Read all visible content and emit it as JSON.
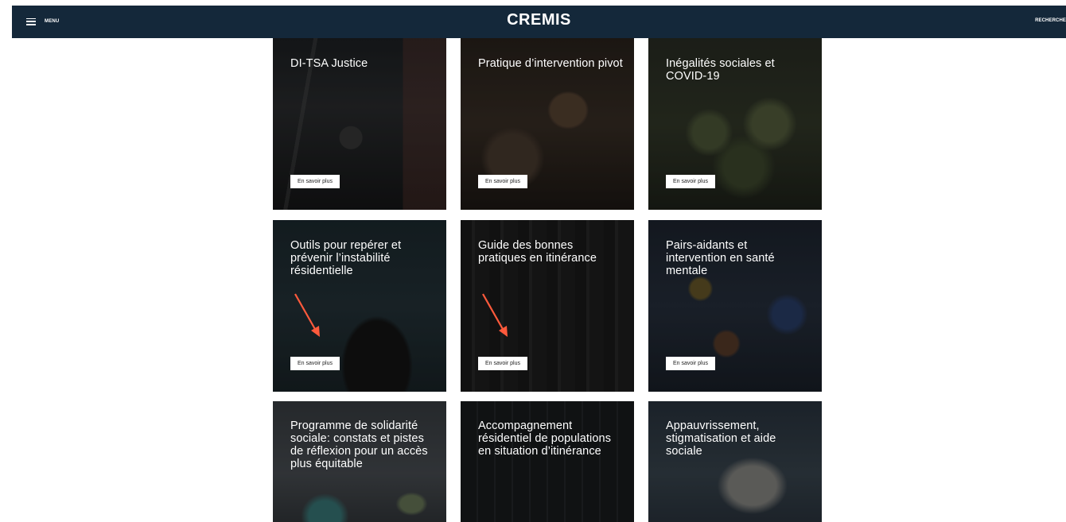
{
  "header": {
    "menu_label": "MENU",
    "brand": "CREMIS",
    "search_label": "RECHERCHE"
  },
  "colors": {
    "header_bg": "#14283a",
    "annotation_arrow": "#ff5a3c"
  },
  "cards": [
    {
      "title": "DI-TSA Justice",
      "button": "En savoir plus"
    },
    {
      "title": "Pratique d’intervention pivot",
      "button": "En savoir plus"
    },
    {
      "title": "Inégalités sociales et COVID-19",
      "button": "En savoir plus"
    },
    {
      "title": "Outils pour repérer et prévenir l’instabilité résidentielle",
      "button": "En savoir plus"
    },
    {
      "title": "Guide des bonnes pratiques en itinérance",
      "button": "En savoir plus"
    },
    {
      "title": "Pairs-aidants et intervention en santé mentale",
      "button": "En savoir plus"
    },
    {
      "title": "Programme de solidarité sociale: constats et pistes de réflexion pour un accès plus équitable"
    },
    {
      "title": "Accompagnement résidentiel de populations en situation d’itinérance"
    },
    {
      "title": "Appauvrissement, stigmatisation et aide sociale"
    }
  ]
}
